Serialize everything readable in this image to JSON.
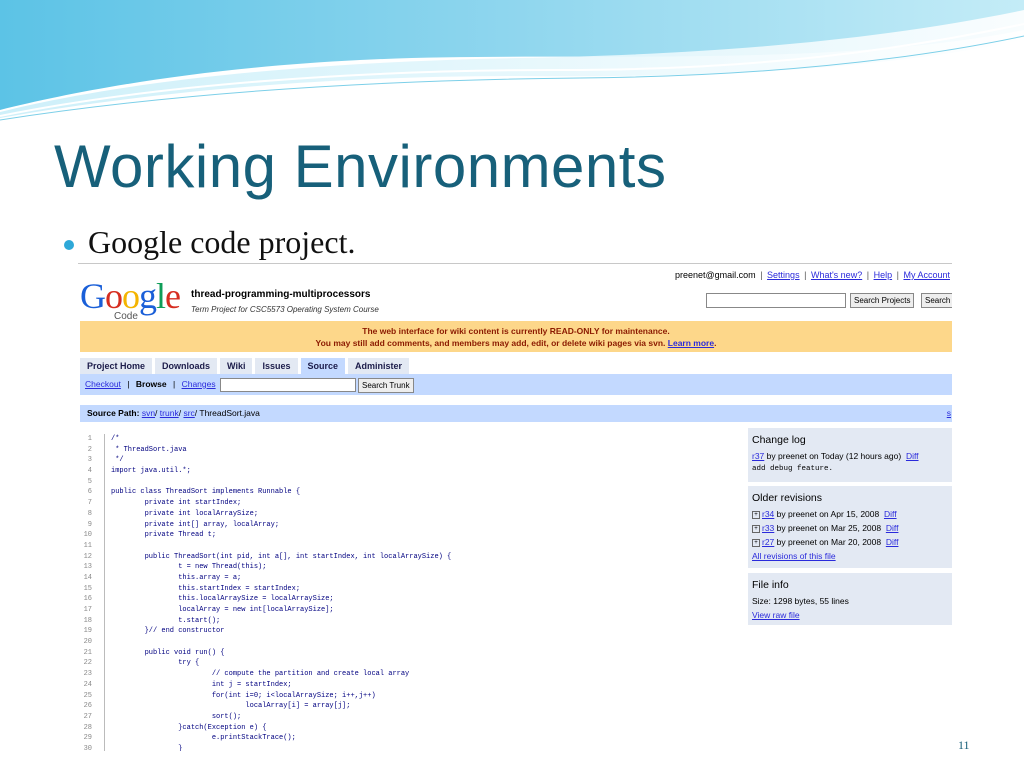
{
  "slide": {
    "title": "Working Environments",
    "bullet": "Google code project.",
    "page_number": "11"
  },
  "colors": {
    "title": "#17607a",
    "bullet": "#2ea8d8",
    "tab_bar": "#c3d9ff",
    "notice_bg": "#fdd78a",
    "link": "#2a2adb"
  },
  "screenshot": {
    "user_bar": {
      "email": "preenet@gmail.com",
      "separator": "|",
      "links": [
        "Settings",
        "What's new?",
        "Help",
        "My Account"
      ]
    },
    "logo": {
      "word": "Google",
      "sub": "Code"
    },
    "project": {
      "name": "thread-programming-multiprocessors",
      "subtitle": "Term Project for CSC5573 Operating System Course"
    },
    "search": {
      "value": "",
      "search_projects_label": "Search Projects",
      "search_web_label": "Search"
    },
    "notice": {
      "line1": "The web interface for wiki content is currently READ-ONLY for maintenance.",
      "line2": "You may still add comments, and members may add, edit, or delete wiki pages via svn.",
      "link": "Learn more",
      "period": "."
    },
    "tabs": [
      "Project Home",
      "Downloads",
      "Wiki",
      "Issues",
      "Source",
      "Administer"
    ],
    "subnav": {
      "checkout": "Checkout",
      "browse": "Browse",
      "changes": "Changes",
      "separator": "|",
      "search_value": "",
      "search_button": "Search Trunk"
    },
    "source_path": {
      "label": "Source Path:",
      "parts": [
        "svn",
        "trunk",
        "src"
      ],
      "slash": "/",
      "file": "ThreadSort.java",
      "right_link": "s"
    },
    "code_lines": [
      {
        "n": "1",
        "t": "/*"
      },
      {
        "n": "2",
        "t": " * ThreadSort.java"
      },
      {
        "n": "3",
        "t": " */"
      },
      {
        "n": "4",
        "t": "import java.util.*;"
      },
      {
        "n": "5",
        "t": ""
      },
      {
        "n": "6",
        "t": "public class ThreadSort implements Runnable {"
      },
      {
        "n": "7",
        "t": "        private int startIndex;"
      },
      {
        "n": "8",
        "t": "        private int localArraySize;"
      },
      {
        "n": "9",
        "t": "        private int[] array, localArray;"
      },
      {
        "n": "10",
        "t": "        private Thread t;"
      },
      {
        "n": "11",
        "t": ""
      },
      {
        "n": "12",
        "t": "        public ThreadSort(int pid, int a[], int startIndex, int localArraySize) {"
      },
      {
        "n": "13",
        "t": "                t = new Thread(this);"
      },
      {
        "n": "14",
        "t": "                this.array = a;"
      },
      {
        "n": "15",
        "t": "                this.startIndex = startIndex;"
      },
      {
        "n": "16",
        "t": "                this.localArraySize = localArraySize;"
      },
      {
        "n": "17",
        "t": "                localArray = new int[localArraySize];"
      },
      {
        "n": "18",
        "t": "                t.start();"
      },
      {
        "n": "19",
        "t": "        }// end constructor"
      },
      {
        "n": "20",
        "t": ""
      },
      {
        "n": "21",
        "t": "        public void run() {"
      },
      {
        "n": "22",
        "t": "                try {"
      },
      {
        "n": "23",
        "t": "                        // compute the partition and create local array"
      },
      {
        "n": "24",
        "t": "                        int j = startIndex;"
      },
      {
        "n": "25",
        "t": "                        for(int i=0; i<localArraySize; i++,j++)"
      },
      {
        "n": "26",
        "t": "                                localArray[i] = array[j];"
      },
      {
        "n": "27",
        "t": "                        sort();"
      },
      {
        "n": "28",
        "t": "                }catch(Exception e) {"
      },
      {
        "n": "29",
        "t": "                        e.printStackTrace();"
      },
      {
        "n": "30",
        "t": "                }"
      }
    ],
    "change_log": {
      "title": "Change log",
      "rev": "r37",
      "by": "by preenet on Today (12 hours ago)",
      "diff": "Diff",
      "message": "add debug feature."
    },
    "older_revisions": {
      "title": "Older revisions",
      "items": [
        {
          "rev": "r34",
          "by": "by preenet on Apr 15, 2008",
          "diff": "Diff"
        },
        {
          "rev": "r33",
          "by": "by preenet on Mar 25, 2008",
          "diff": "Diff"
        },
        {
          "rev": "r27",
          "by": "by preenet on Mar 20, 2008",
          "diff": "Diff"
        }
      ],
      "all_link": "All revisions of this file"
    },
    "file_info": {
      "title": "File info",
      "size": "Size: 1298 bytes, 55 lines",
      "raw_link": "View raw file"
    }
  }
}
